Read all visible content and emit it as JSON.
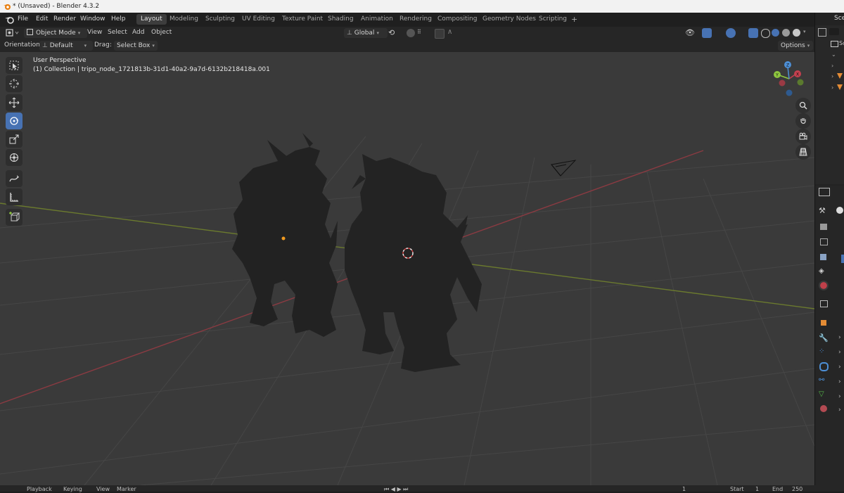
{
  "window": {
    "title": "* (Unsaved) - Blender 4.3.2"
  },
  "menu": {
    "file": "File",
    "edit": "Edit",
    "render": "Render",
    "window": "Window",
    "help": "Help"
  },
  "workspaces": [
    "Layout",
    "Modeling",
    "Sculpting",
    "UV Editing",
    "Texture Paint",
    "Shading",
    "Animation",
    "Rendering",
    "Compositing",
    "Geometry Nodes",
    "Scripting"
  ],
  "workspace_add": "+",
  "header": {
    "mode": "Object Mode",
    "view": "View",
    "select": "Select",
    "add": "Add",
    "object": "Object",
    "transform_orientation": "Global"
  },
  "tool_settings": {
    "orientation_label": "Orientation:",
    "orientation_value": "Default",
    "drag_label": "Drag:",
    "drag_value": "Select Box",
    "options": "Options"
  },
  "viewport": {
    "perspective": "User Perspective",
    "collection": "(1) Collection | tripo_node_1721813b-31d1-40a2-9a7d-6132b218418a.001"
  },
  "gizmo": {
    "x": "X",
    "y": "Y",
    "z": "Z"
  },
  "right_panel": {
    "scene_label": "Sce",
    "scene_sub": "Sc"
  },
  "bottom": {
    "playback": "Playback",
    "keying": "Keying",
    "view": "View",
    "marker": "Marker",
    "start_label": "Start",
    "start_value": "1",
    "end_label": "End",
    "end_value": "250",
    "current_frame": "1"
  },
  "colors": {
    "accent": "#4772b3",
    "x_axis": "#c4404f",
    "y_axis": "#8ec63f",
    "z_axis": "#4d8fd6",
    "viewport_bg": "#3a3a3a",
    "active_tool": "#4772b3"
  }
}
